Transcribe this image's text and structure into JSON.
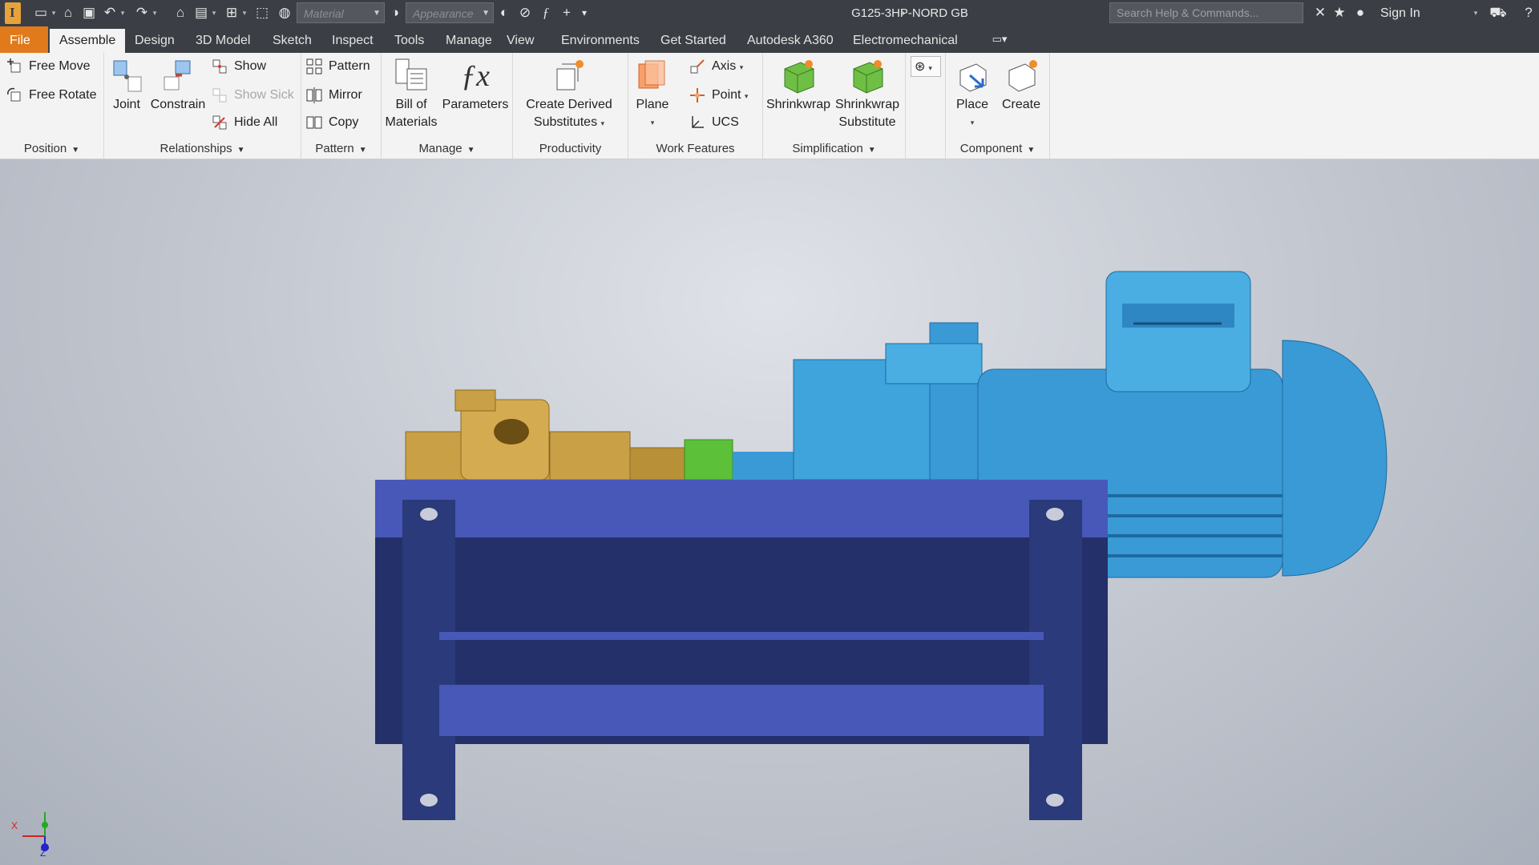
{
  "titlebar": {
    "material_combo": "Material",
    "appearance_combo": "Appearance",
    "document_title": "G125-3HP-NORD GB",
    "search_placeholder": "Search Help & Commands...",
    "sign_in": "Sign In",
    "icons": [
      "new-file-icon",
      "open-icon",
      "save-icon",
      "undo-icon",
      "redo-icon",
      "home-icon",
      "print-icon",
      "measure-icon",
      "select-icon",
      "color-icon",
      "appearance-icon",
      "clear-override-icon",
      "fx-icon",
      "plus-icon",
      "customize-icon",
      "exchange-icon",
      "star-icon",
      "user-icon",
      "cart-icon",
      "help-icon"
    ]
  },
  "tabs": [
    "File",
    "Assemble",
    "Design",
    "3D Model",
    "Sketch",
    "Inspect",
    "Tools",
    "Manage",
    "View",
    "Environments",
    "Get Started",
    "Autodesk A360",
    "Electromechanical"
  ],
  "active_tab": "Assemble",
  "colors": {
    "file_tab": "#e07a1a",
    "frame": "#2a3a7a",
    "motor": "#3a9ad6",
    "pump": "#c9a045",
    "coupling": "#5cc038"
  },
  "ribbon": {
    "position": {
      "label": "Position",
      "free_move": "Free Move",
      "free_rotate": "Free Rotate"
    },
    "relationships": {
      "label": "Relationships",
      "joint": "Joint",
      "constrain": "Constrain",
      "show": "Show",
      "show_sick": "Show Sick",
      "hide_all": "Hide All"
    },
    "pattern": {
      "label": "Pattern",
      "pattern": "Pattern",
      "mirror": "Mirror",
      "copy": "Copy"
    },
    "manage": {
      "label": "Manage",
      "bom_line1": "Bill of",
      "bom_line2": "Materials",
      "parameters": "Parameters"
    },
    "productivity": {
      "label": "Productivity",
      "derived_line1": "Create Derived",
      "derived_line2": "Substitutes"
    },
    "work_features": {
      "label": "Work Features",
      "plane": "Plane",
      "axis": "Axis",
      "point": "Point",
      "ucs": "UCS"
    },
    "simplification": {
      "label": "Simplification",
      "shrinkwrap": "Shrinkwrap",
      "shrinkwrap_sub_line1": "Shrinkwrap",
      "shrinkwrap_sub_line2": "Substitute"
    },
    "component": {
      "label": "Component",
      "place": "Place",
      "create": "Create"
    }
  },
  "viewport": {
    "triad_x": "X",
    "triad_z": "Z"
  }
}
